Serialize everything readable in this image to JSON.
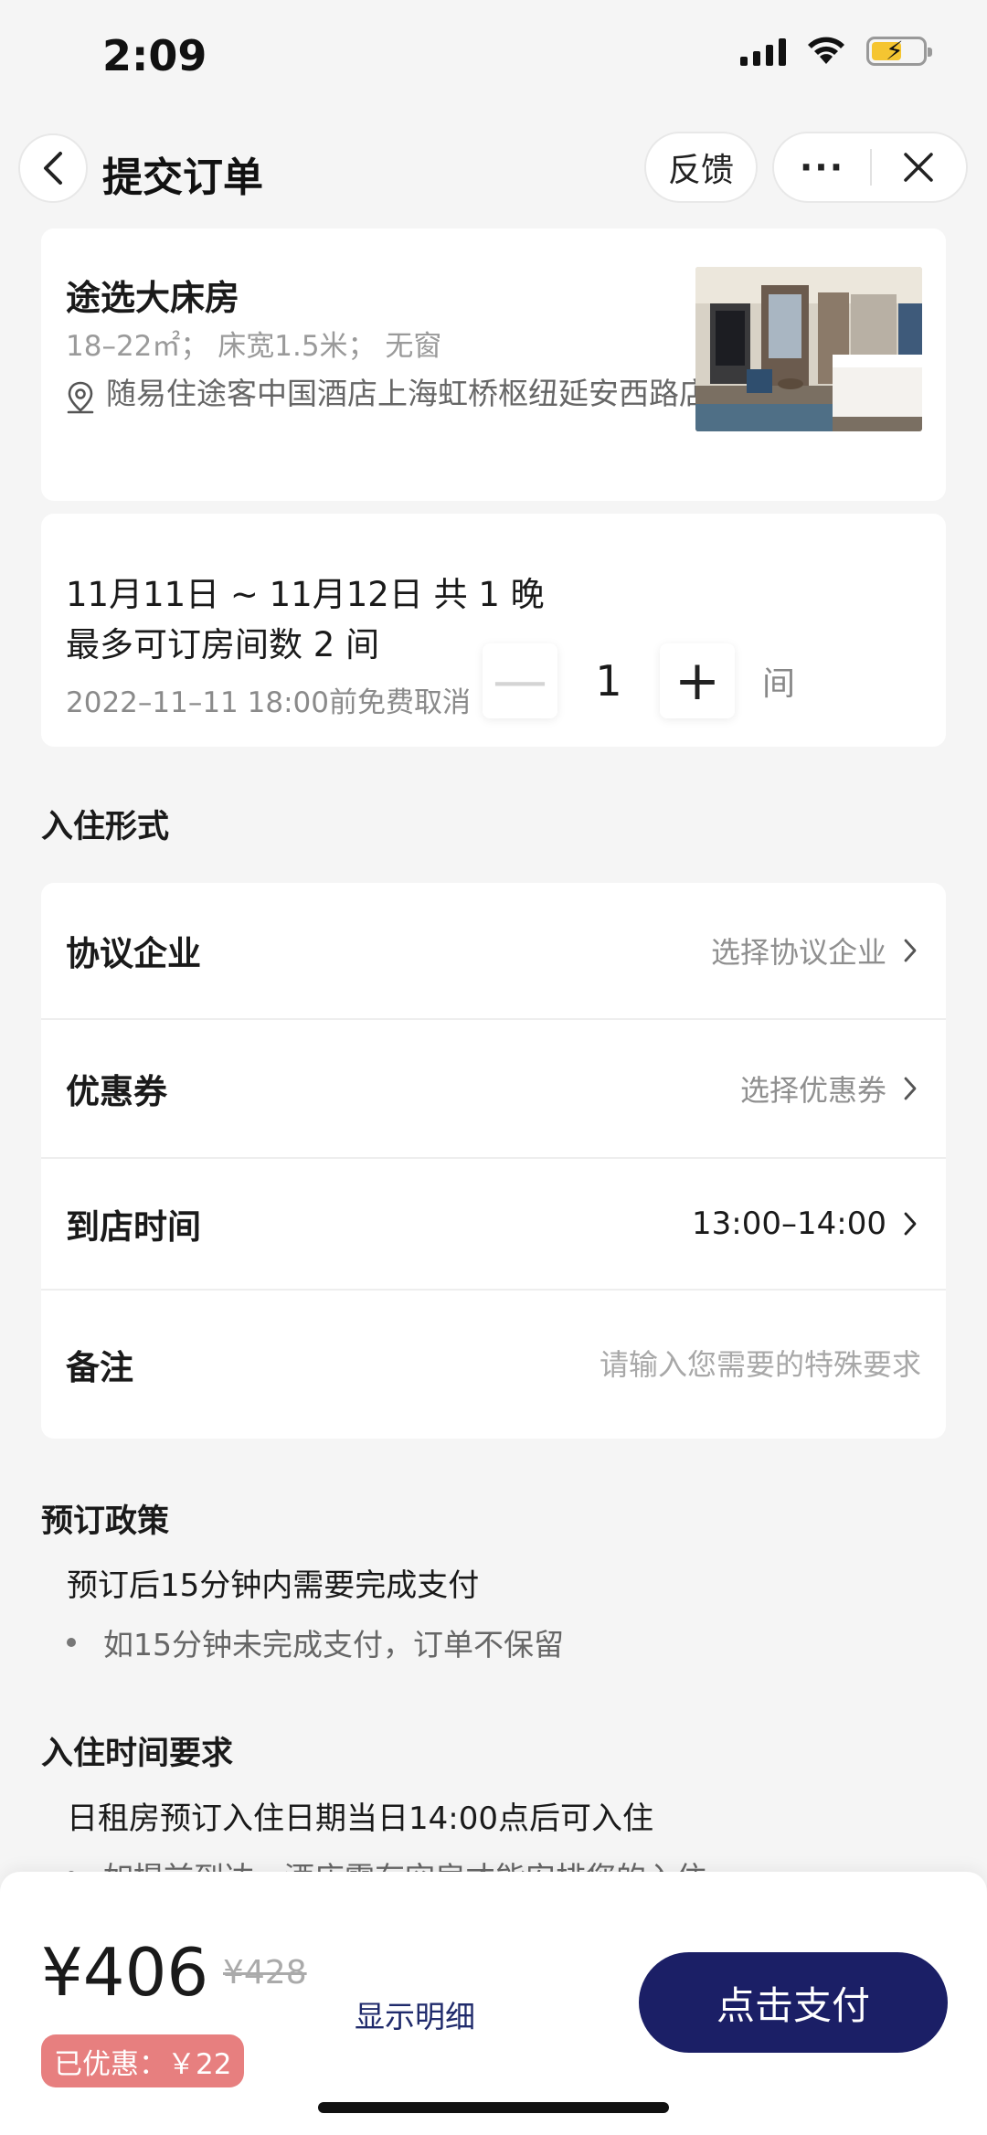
{
  "status_bar": {
    "time": "2:09"
  },
  "nav": {
    "title": "提交订单",
    "feedback_label": "反馈",
    "more_label": "···"
  },
  "room": {
    "name": "途选大床房",
    "specs": "18–22㎡；  床宽1.5米；  无窗",
    "address": "随易住途客中国酒店上海虹桥枢纽延安西路店"
  },
  "booking": {
    "dates": "11月11日 ~ 11月12日 共 1 晚",
    "max_rooms": "最多可订房间数 2 间",
    "cancel_note": "2022–11–11 18:00前免费取消",
    "minus_label": "—",
    "quantity": "1",
    "plus_label": "+",
    "unit": "间"
  },
  "checkin_section": {
    "title": "入住形式",
    "rows": [
      {
        "label": "协议企业",
        "value": "选择协议企业"
      },
      {
        "label": "优惠券",
        "value": "选择优惠券"
      },
      {
        "label": "到店时间",
        "value": "13:00–14:00"
      },
      {
        "label": "备注",
        "placeholder": "请输入您需要的特殊要求"
      }
    ]
  },
  "policy": {
    "title": "预订政策",
    "lead": "预订后15分钟内需要完成支付",
    "bullet": "如15分钟未完成支付，订单不保留"
  },
  "time_requirement": {
    "title": "入住时间要求",
    "lead": "日租房预订入住日期当日14:00点后可入住",
    "bullet": "如提前到达，酒店需有空房才能安排您的入住"
  },
  "footer": {
    "price": "¥406",
    "original_price": "¥428",
    "details_link": "显示明细",
    "discount": "已优惠：￥22",
    "pay_button": "点击支付"
  },
  "colors": {
    "pay_button": "#1b1f66",
    "discount_badge": "#e77f7f",
    "link": "#1f2a6b"
  }
}
